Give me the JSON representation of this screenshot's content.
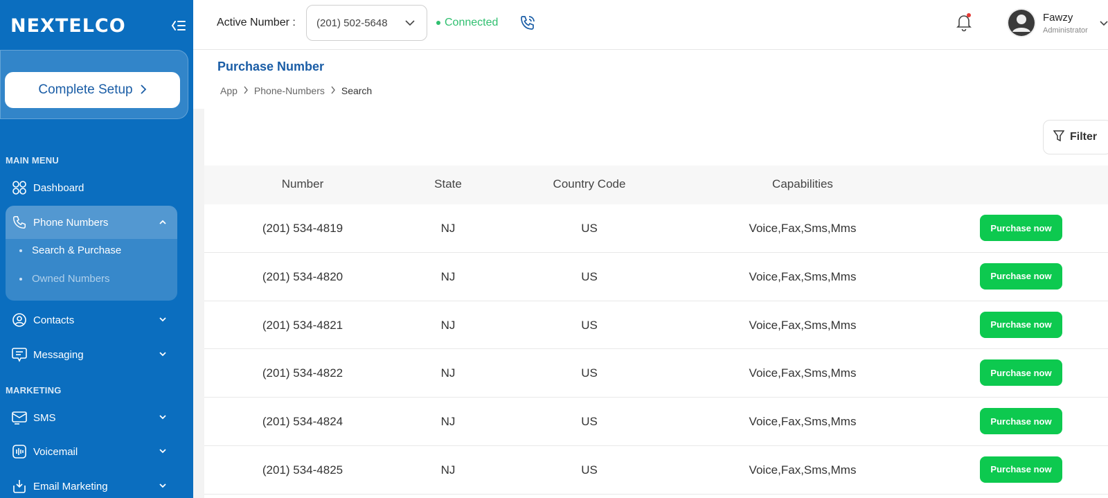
{
  "brand": {
    "logo_text": "NEXTELCO"
  },
  "sidebar": {
    "setup_label": "Complete Setup",
    "main_menu_heading": "MAIN MENU",
    "marketing_heading": "MARKETING",
    "dashboard": "Dashboard",
    "phone_numbers": "Phone Numbers",
    "sub_search": "Search & Purchase",
    "sub_owned": "Owned Numbers",
    "contacts": "Contacts",
    "messaging": "Messaging",
    "sms": "SMS",
    "voicemail": "Voicemail",
    "email_marketing": "Email Marketing"
  },
  "header": {
    "active_label": "Active Number :",
    "active_number": "(201) 502-5648",
    "status": "Connected",
    "user_name": "Fawzy",
    "user_role": "Administrator"
  },
  "page": {
    "title": "Purchase Number",
    "breadcrumb": [
      "App",
      "Phone-Numbers",
      "Search"
    ],
    "filter_label": "Filter"
  },
  "table": {
    "columns": [
      "Number",
      "State",
      "Country Code",
      "Capabilities"
    ],
    "action_label": "Purchase now",
    "rows": [
      {
        "number": "(201) 534-4819",
        "state": "NJ",
        "country": "US",
        "caps": "Voice,Fax,Sms,Mms"
      },
      {
        "number": "(201) 534-4820",
        "state": "NJ",
        "country": "US",
        "caps": "Voice,Fax,Sms,Mms"
      },
      {
        "number": "(201) 534-4821",
        "state": "NJ",
        "country": "US",
        "caps": "Voice,Fax,Sms,Mms"
      },
      {
        "number": "(201) 534-4822",
        "state": "NJ",
        "country": "US",
        "caps": "Voice,Fax,Sms,Mms"
      },
      {
        "number": "(201) 534-4824",
        "state": "NJ",
        "country": "US",
        "caps": "Voice,Fax,Sms,Mms"
      },
      {
        "number": "(201) 534-4825",
        "state": "NJ",
        "country": "US",
        "caps": "Voice,Fax,Sms,Mms"
      }
    ]
  },
  "colors": {
    "sidebar": "#0b6ebf",
    "accent": "#1a5da6",
    "success": "#0dc94f",
    "connected": "#2fbf6f"
  }
}
